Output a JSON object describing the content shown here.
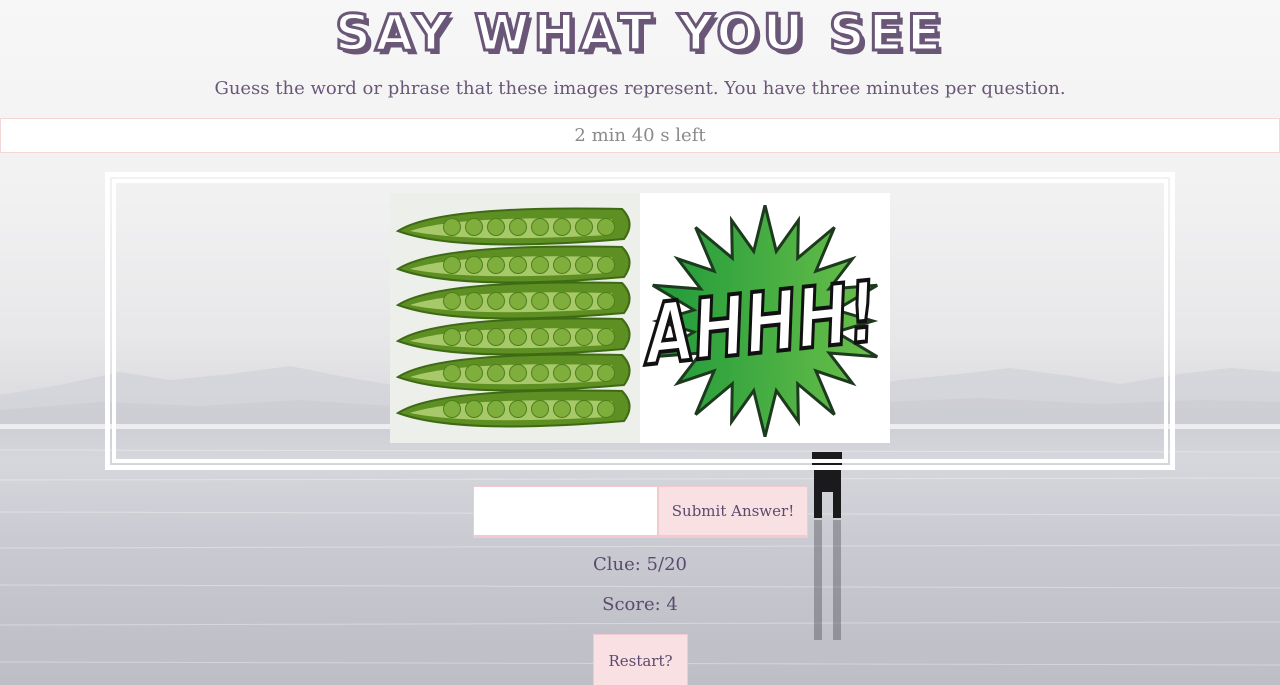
{
  "page": {
    "title": "Say What You See",
    "subtitle": "Guess the word or phrase that these images represent. You have three minutes per question."
  },
  "timer": {
    "label": "2 min 40 s left"
  },
  "puzzle": {
    "images": [
      {
        "name": "peas-in-pods-image",
        "icon": "peas-pods"
      },
      {
        "name": "ahhh-burst-image",
        "icon": "comic-burst",
        "text": "AHHH!"
      }
    ]
  },
  "answer": {
    "input_value": "",
    "input_placeholder": "",
    "submit_label": "Submit Answer!"
  },
  "status": {
    "clue_label": "Clue: 5/20",
    "score_label": "Score: 4"
  },
  "restart": {
    "label": "Restart?"
  },
  "colors": {
    "accent_purple": "#6a5778",
    "button_pink": "#f9e1e3",
    "border_pink": "#f1c9ce",
    "pea_green": "#7fae3c",
    "burst_green": "#39b54a"
  }
}
